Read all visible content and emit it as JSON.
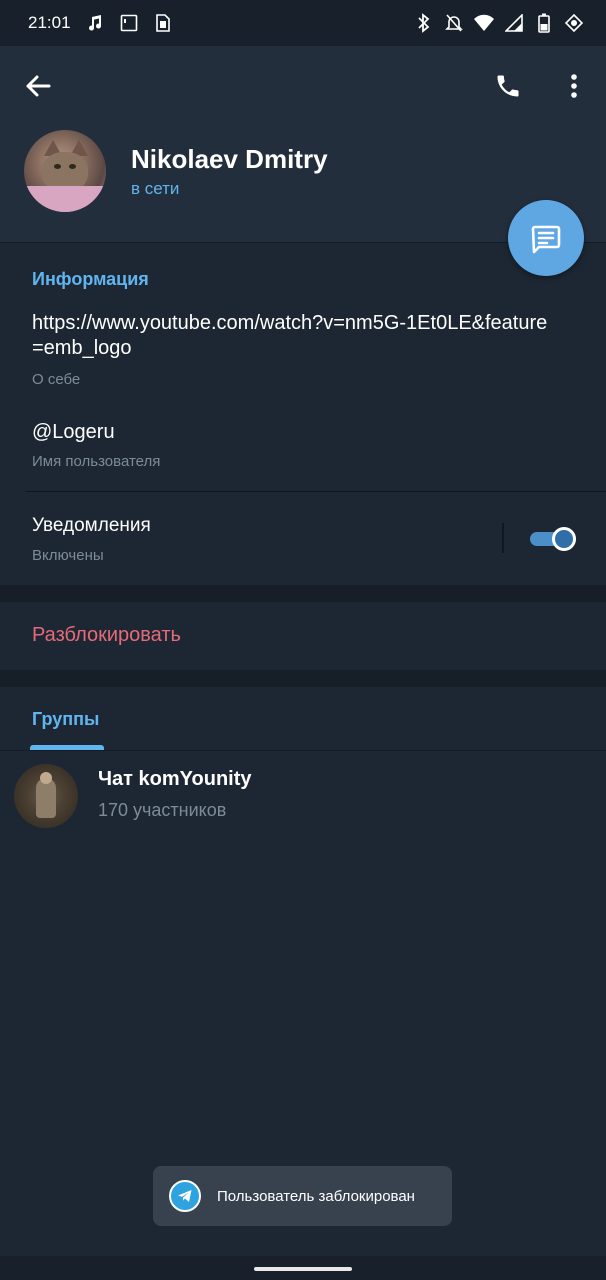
{
  "status_bar": {
    "time": "21:01",
    "left_icons": [
      "music-note-icon",
      "square-notification-icon",
      "sim-card-icon"
    ],
    "right_icons": [
      "bluetooth-icon",
      "mute-icon",
      "wifi-icon",
      "signal-icon",
      "battery-icon",
      "vpn-icon"
    ]
  },
  "header": {
    "name": "Nikolaev Dmitry",
    "status": "в сети"
  },
  "info": {
    "title": "Информация",
    "bio": "https://www.youtube.com/watch?v=nm5G-1Et0LE&feature=emb_logo",
    "bio_label": "О себе",
    "username": "@Logeru",
    "username_label": "Имя пользователя",
    "notifications_label": "Уведомления",
    "notifications_status": "Включены",
    "notifications_enabled": true
  },
  "actions": {
    "unblock": "Разблокировать"
  },
  "tabs": {
    "groups": "Группы"
  },
  "groups": [
    {
      "name": "Чат komYounity",
      "members": "170 участников"
    }
  ],
  "toast": {
    "text": "Пользователь заблокирован"
  },
  "colors": {
    "accent": "#61b5ef",
    "fab": "#5ea7e3",
    "danger": "#e56b78",
    "background": "#1d2733",
    "header": "#232e3c"
  }
}
